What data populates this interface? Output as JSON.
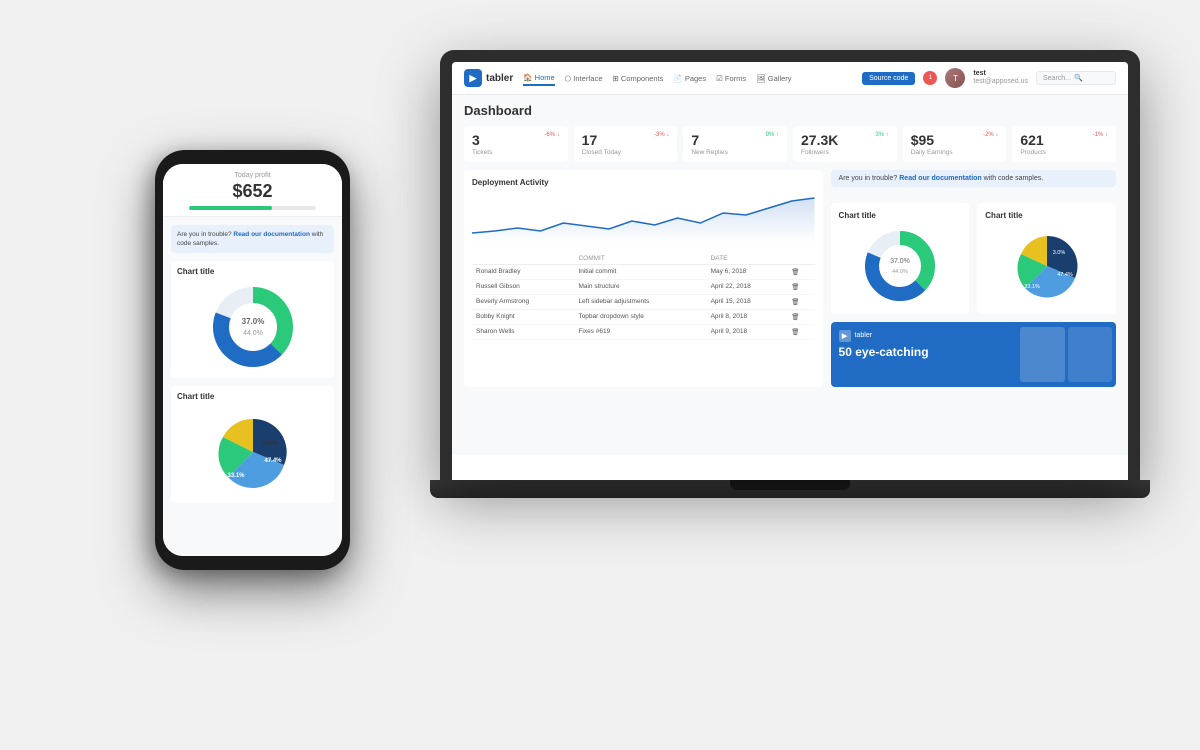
{
  "scene": {
    "background": "#f0f0f0"
  },
  "laptop": {
    "nav": {
      "brand": "tabler",
      "brand_icon": "▶",
      "links": [
        "Home",
        "Interface",
        "Components",
        "Pages",
        "Forms",
        "Gallery"
      ],
      "active_link": "Home",
      "source_code_btn": "Source code",
      "search_placeholder": "Search...",
      "user_name": "test",
      "user_email": "test@apposed.us",
      "notif_count": "1"
    },
    "dashboard": {
      "title": "Dashboard",
      "stats": [
        {
          "value": "3",
          "label": "Tickets",
          "change": "-6%",
          "trend": "down"
        },
        {
          "value": "17",
          "label": "Closed Today",
          "change": "-3%",
          "trend": "down"
        },
        {
          "value": "7",
          "label": "New Replies",
          "change": "9%",
          "trend": "up"
        },
        {
          "value": "27.3K",
          "label": "Followers",
          "change": "3%",
          "trend": "up"
        },
        {
          "value": "$95",
          "label": "Daily Earnings",
          "change": "-2%",
          "trend": "down"
        },
        {
          "value": "621",
          "label": "Products",
          "change": "-1%",
          "trend": "down"
        }
      ],
      "alert": {
        "text_before": "Are you in trouble? ",
        "link_text": "Read our documentation",
        "text_after": " with code samples."
      },
      "activity": {
        "title": "Deployment Activity",
        "table_headers": [
          "COMMIT",
          "DATE"
        ],
        "rows": [
          {
            "name": "Ronald Bradley",
            "commit": "Initial commit",
            "date": "May 6, 2018"
          },
          {
            "name": "Russell Gibson",
            "commit": "Main structure",
            "date": "April 22, 2018"
          },
          {
            "name": "Beverly Armstrong",
            "commit": "Left sidebar adjustments",
            "date": "April 15, 2018"
          },
          {
            "name": "Bobby Knight",
            "commit": "Topbar dropdown style",
            "date": "April 8, 2018"
          },
          {
            "name": "Sharon Wells",
            "commit": "Fixes #619",
            "date": "April 9, 2018"
          }
        ]
      },
      "chart_title_1": "Chart title",
      "chart_title_2": "Chart title",
      "donut1": {
        "segments": [
          {
            "value": 37.0,
            "color": "#2bc97a",
            "label": "37.0%"
          },
          {
            "value": 44.0,
            "color": "#206bc4",
            "label": "44.0%"
          },
          {
            "value": 19.0,
            "color": "#e8eef5",
            "label": "19.0%"
          }
        ]
      },
      "donut2": {
        "segments": [
          {
            "value": 47.4,
            "color": "#1a3e6e",
            "label": "47.4%"
          },
          {
            "value": 33.1,
            "color": "#4d9de0",
            "label": "33.1%"
          },
          {
            "value": 9.0,
            "color": "#2bc97a",
            "label": "9.0%"
          },
          {
            "value": 10.5,
            "color": "#e8c020",
            "label": "10.5%"
          }
        ]
      },
      "promo": {
        "brand": "tabler",
        "title": "50 eye-catching"
      }
    }
  },
  "phone": {
    "header_label": "Today profit",
    "header_value": "$652",
    "progress": 65,
    "alert": {
      "text_before": "Are you in trouble? ",
      "link_text": "Read our documentation",
      "text_after": " with code samples."
    },
    "chart1_title": "Chart title",
    "chart2_title": "Chart title",
    "donut1": {
      "segments": [
        {
          "value": 37.0,
          "color": "#2bc97a",
          "label": "37.0%"
        },
        {
          "value": 44.0,
          "color": "#206bc4",
          "label": "44.0%"
        },
        {
          "value": 19.0,
          "color": "#e8eef5",
          "label": "19.0%"
        }
      ]
    },
    "donut2": {
      "segments": [
        {
          "value": 47.4,
          "color": "#1a3e6e",
          "label": "47.4%"
        },
        {
          "value": 33.1,
          "color": "#4d9de0",
          "label": "33.1%"
        },
        {
          "value": 9.0,
          "color": "#2bc97a",
          "label": "9.0%"
        },
        {
          "value": 10.5,
          "color": "#e8c020",
          "label": "10.5%"
        }
      ]
    }
  }
}
